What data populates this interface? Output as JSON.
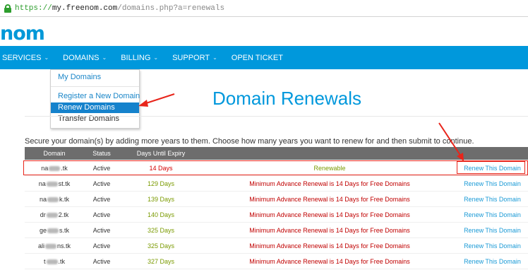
{
  "browser": {
    "url_scheme": "https://",
    "url_host": "my.freenom.com",
    "url_path": "/domains.php?a=renewals"
  },
  "logo": {
    "text": "nom"
  },
  "nav": {
    "items": [
      {
        "label": "SERVICES",
        "caret": "⌄"
      },
      {
        "label": "DOMAINS",
        "caret": "⌄"
      },
      {
        "label": "BILLING",
        "caret": "⌄"
      },
      {
        "label": "SUPPORT",
        "caret": "⌄"
      },
      {
        "label": "OPEN TICKET"
      }
    ]
  },
  "dropdown": {
    "items": [
      {
        "label": "My Domains"
      },
      {
        "label": "Register a New Domain"
      },
      {
        "label": "Renew Domains",
        "active": true
      },
      {
        "label": "Transfer Domains"
      }
    ]
  },
  "page": {
    "title": "Domain Renewals",
    "intro": "Secure your domain(s) by adding more years to them. Choose how many years you want to renew for and then submit to continue."
  },
  "table": {
    "headers": [
      "Domain",
      "Status",
      "Days Until Expiry"
    ],
    "rows": [
      {
        "domain_a": "na",
        "domain_b": ".tk",
        "status": "Active",
        "days": "14 Days",
        "message": "Renewable",
        "action": "Renew This Domain"
      },
      {
        "domain_a": "na",
        "domain_b": "st.tk",
        "status": "Active",
        "days": "129 Days",
        "message": "Minimum Advance Renewal is 14 Days for Free Domains",
        "action": "Renew This Domain"
      },
      {
        "domain_a": "na",
        "domain_b": "k.tk",
        "status": "Active",
        "days": "139 Days",
        "message": "Minimum Advance Renewal is 14 Days for Free Domains",
        "action": "Renew This Domain"
      },
      {
        "domain_a": "dr",
        "domain_b": "2.tk",
        "status": "Active",
        "days": "140 Days",
        "message": "Minimum Advance Renewal is 14 Days for Free Domains",
        "action": "Renew This Domain"
      },
      {
        "domain_a": "ge",
        "domain_b": "s.tk",
        "status": "Active",
        "days": "325 Days",
        "message": "Minimum Advance Renewal is 14 Days for Free Domains",
        "action": "Renew This Domain"
      },
      {
        "domain_a": "ali",
        "domain_b": "ns.tk",
        "status": "Active",
        "days": "325 Days",
        "message": "Minimum Advance Renewal is 14 Days for Free Domains",
        "action": "Renew This Domain"
      },
      {
        "domain_a": "t",
        "domain_b": ".tk",
        "status": "Active",
        "days": "327 Days",
        "message": "Minimum Advance Renewal is 14 Days for Free Domains",
        "action": "Renew This Domain"
      }
    ]
  },
  "colors": {
    "brand_blue": "#0098dc",
    "link_blue": "#1a9ad6",
    "annotation_red": "#e8241a",
    "days_red": "#d40000",
    "days_green": "#7a9a00"
  }
}
